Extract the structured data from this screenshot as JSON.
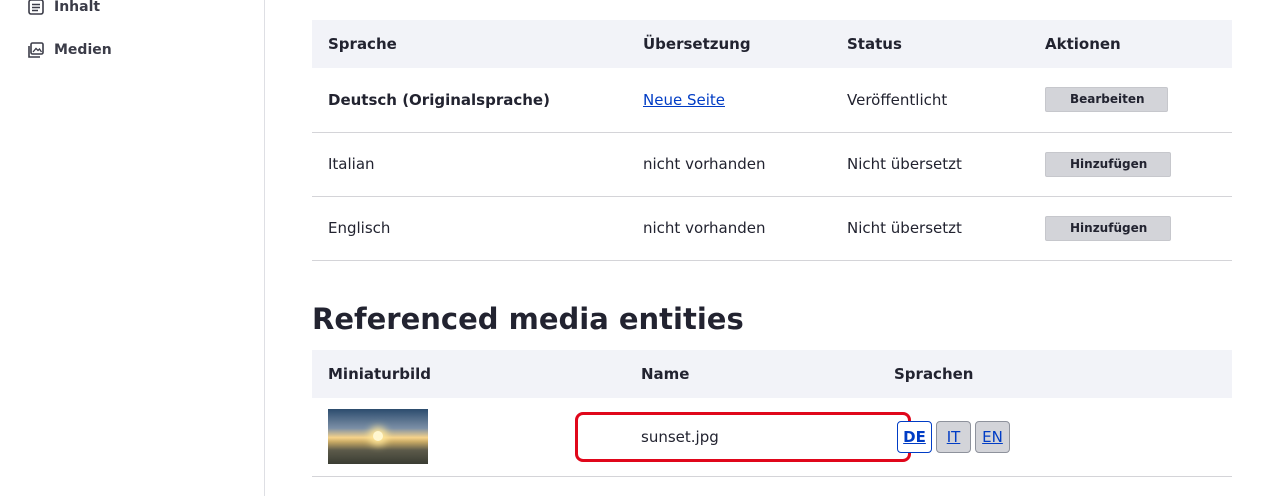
{
  "sidebar": {
    "items": [
      {
        "label": "Inhalt",
        "icon": "content-icon"
      },
      {
        "label": "Medien",
        "icon": "media-icon"
      }
    ]
  },
  "translations": {
    "headers": [
      "Sprache",
      "Übersetzung",
      "Status",
      "Aktionen"
    ],
    "rows": [
      {
        "language": "Deutsch (Originalsprache)",
        "translation": "Neue Seite",
        "status": "Veröffentlicht",
        "action": "Bearbeiten"
      },
      {
        "language": "Italian",
        "translation": "nicht vorhanden",
        "status": "Nicht übersetzt",
        "action": "Hinzufügen"
      },
      {
        "language": "Englisch",
        "translation": "nicht vorhanden",
        "status": "Nicht übersetzt",
        "action": "Hinzufügen"
      }
    ]
  },
  "media": {
    "title": "Referenced media entities",
    "headers": [
      "Miniaturbild",
      "Name",
      "Sprachen"
    ],
    "rows": [
      {
        "name": "sunset.jpg",
        "languages": [
          "DE",
          "IT",
          "EN"
        ]
      }
    ]
  },
  "colors": {
    "highlight": "#e0071b",
    "link": "#003cc5",
    "header_bg": "#f2f3f8"
  }
}
